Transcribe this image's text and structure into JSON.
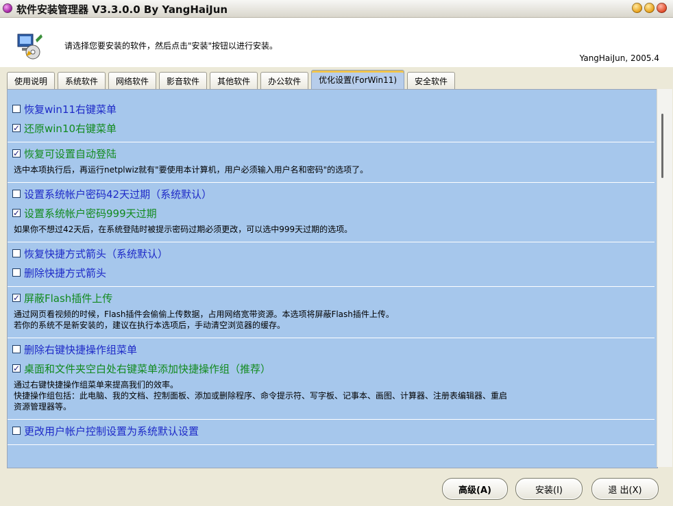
{
  "window": {
    "title": "软件安装管理器 V3.3.0.0 By YangHaiJun"
  },
  "header": {
    "instruction": "请选择您要安装的软件，然后点击\"安装\"按钮以进行安装。",
    "author": "YangHaiJun, 2005.4"
  },
  "tabs": [
    {
      "label": "使用说明"
    },
    {
      "label": "系统软件"
    },
    {
      "label": "网络软件"
    },
    {
      "label": "影音软件"
    },
    {
      "label": "其他软件"
    },
    {
      "label": "办公软件"
    },
    {
      "label": "优化设置(ForWin11)",
      "active": true
    },
    {
      "label": "安全软件"
    }
  ],
  "options": {
    "g1": {
      "o1": {
        "label": "恢复win11右键菜单",
        "checked": false
      },
      "o2": {
        "label": "还原win10右键菜单",
        "checked": true
      }
    },
    "g2": {
      "o1": {
        "label": "恢复可设置自动登陆",
        "checked": true
      },
      "desc": "选中本项执行后，再运行netplwiz就有\"要使用本计算机，用户必须输入用户名和密码\"的选项了。"
    },
    "g3": {
      "o1": {
        "label": "设置系统帐户密码42天过期（系统默认）",
        "checked": false
      },
      "o2": {
        "label": "设置系统帐户密码999天过期",
        "checked": true
      },
      "desc": "如果你不想过42天后，在系统登陆时被提示密码过期必须更改，可以选中999天过期的选项。"
    },
    "g4": {
      "o1": {
        "label": "恢复快捷方式箭头（系统默认）",
        "checked": false
      },
      "o2": {
        "label": "删除快捷方式箭头",
        "checked": false
      }
    },
    "g5": {
      "o1": {
        "label": "屏蔽Flash插件上传",
        "checked": true
      },
      "desc1": "通过网页看视频的时候，Flash插件会偷偷上传数据，占用网络宽带资源。本选项将屏蔽Flash插件上传。",
      "desc2": "若你的系统不是新安装的，建议在执行本选项后，手动清空浏览器的缓存。"
    },
    "g6": {
      "o1": {
        "label": "删除右键快捷操作组菜单",
        "checked": false
      },
      "o2": {
        "label": "桌面和文件夹空白处右键菜单添加快捷操作组（推荐）",
        "checked": true
      },
      "desc1": "通过右键快捷操作组菜单来提高我们的效率。",
      "desc2": "快捷操作组包括：此电脑、我的文档、控制面板、添加或删除程序、命令提示符、写字板、记事本、画图、计算器、注册表编辑器、重启",
      "desc3": "资源管理器等。"
    },
    "g7": {
      "o1": {
        "label": "更改用户帐户控制设置为系统默认设置",
        "checked": false
      }
    }
  },
  "check_mark": "✓",
  "buttons": {
    "advanced": "高级(A)",
    "install": "安装(I)",
    "exit": "退 出(X)"
  },
  "colors": {
    "panel_bg": "#a6c7ec",
    "checked_text": "#118a1d",
    "unchecked_text": "#1d29c7"
  }
}
